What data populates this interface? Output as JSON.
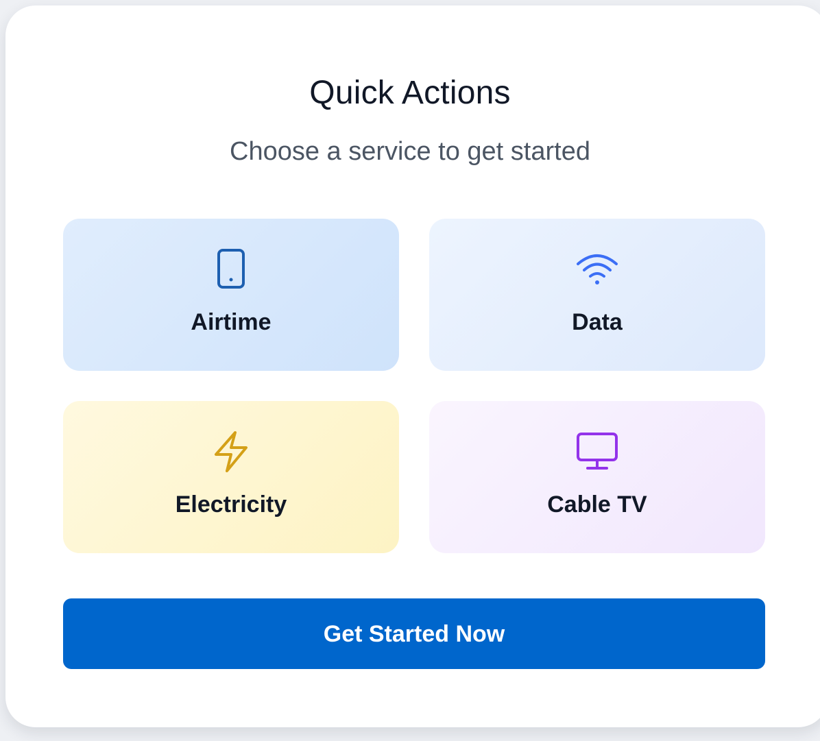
{
  "header": {
    "title": "Quick Actions",
    "subtitle": "Choose a service to get started"
  },
  "services": [
    {
      "label": "Airtime",
      "icon": "smartphone-icon",
      "color": "#1d5fb0"
    },
    {
      "label": "Data",
      "icon": "wifi-icon",
      "color": "#3b6ef5"
    },
    {
      "label": "Electricity",
      "icon": "lightning-icon",
      "color": "#d4a017"
    },
    {
      "label": "Cable TV",
      "icon": "monitor-icon",
      "color": "#9333ea"
    }
  ],
  "cta": {
    "label": "Get Started Now",
    "color": "#0066cc"
  }
}
